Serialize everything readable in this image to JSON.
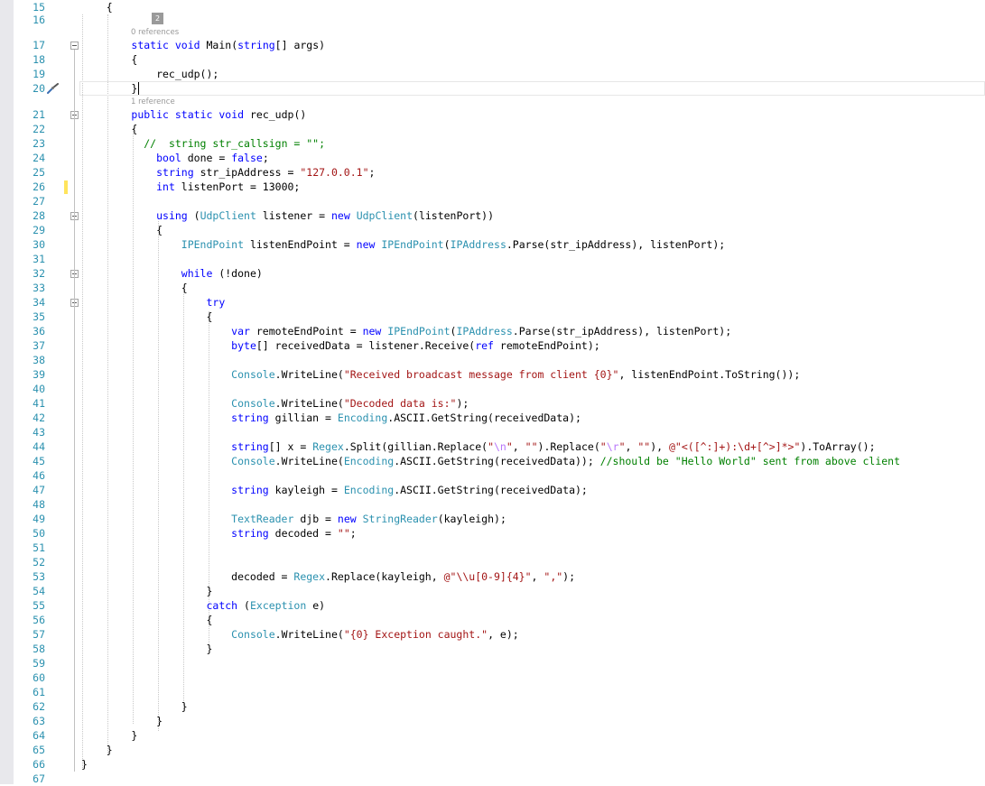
{
  "editor": {
    "colors": {
      "keyword": "#0000ff",
      "type": "#2b91af",
      "string": "#a31515",
      "comment": "#008000",
      "line_number": "#2b91af",
      "change_marker": "#ffe45c"
    },
    "hint_badge": "2",
    "ref_hints": [
      {
        "text": "0 references",
        "before_line": 17
      },
      {
        "text": "1 reference",
        "before_line": 21
      }
    ],
    "quick_action_icon": "screwdriver-brush-icon",
    "lines": [
      {
        "n": "15",
        "tokens": [
          [
            "p",
            "    {"
          ]
        ]
      },
      {
        "n": "16",
        "tokens": []
      },
      {
        "n": "17",
        "tokens": [
          [
            "p",
            "        "
          ],
          [
            "k",
            "static"
          ],
          [
            "p",
            " "
          ],
          [
            "k",
            "void"
          ],
          [
            "p",
            " Main("
          ],
          [
            "k",
            "string"
          ],
          [
            "p",
            "[] args)"
          ]
        ]
      },
      {
        "n": "18",
        "tokens": [
          [
            "p",
            "        {"
          ]
        ]
      },
      {
        "n": "19",
        "tokens": [
          [
            "p",
            "            rec_udp();"
          ]
        ]
      },
      {
        "n": "20",
        "tokens": [
          [
            "p",
            "        }"
          ]
        ]
      },
      {
        "n": "21",
        "tokens": [
          [
            "p",
            "        "
          ],
          [
            "k",
            "public"
          ],
          [
            "p",
            " "
          ],
          [
            "k",
            "static"
          ],
          [
            "p",
            " "
          ],
          [
            "k",
            "void"
          ],
          [
            "p",
            " rec_udp()"
          ]
        ]
      },
      {
        "n": "22",
        "tokens": [
          [
            "p",
            "        {"
          ]
        ]
      },
      {
        "n": "23",
        "tokens": [
          [
            "p",
            "          "
          ],
          [
            "c",
            "//  string str_callsign = \"\";"
          ]
        ]
      },
      {
        "n": "24",
        "tokens": [
          [
            "p",
            "            "
          ],
          [
            "k",
            "bool"
          ],
          [
            "p",
            " done = "
          ],
          [
            "k",
            "false"
          ],
          [
            "p",
            ";"
          ]
        ]
      },
      {
        "n": "25",
        "tokens": [
          [
            "p",
            "            "
          ],
          [
            "k",
            "string"
          ],
          [
            "p",
            " str_ipAddress = "
          ],
          [
            "s",
            "\"127.0.0.1\""
          ],
          [
            "p",
            ";"
          ]
        ]
      },
      {
        "n": "26",
        "tokens": [
          [
            "p",
            "            "
          ],
          [
            "k",
            "int"
          ],
          [
            "p",
            " listenPort = 13000;"
          ]
        ]
      },
      {
        "n": "27",
        "tokens": []
      },
      {
        "n": "28",
        "tokens": [
          [
            "p",
            "            "
          ],
          [
            "k",
            "using"
          ],
          [
            "p",
            " ("
          ],
          [
            "t",
            "UdpClient"
          ],
          [
            "p",
            " listener = "
          ],
          [
            "k",
            "new"
          ],
          [
            "p",
            " "
          ],
          [
            "t",
            "UdpClient"
          ],
          [
            "p",
            "(listenPort))"
          ]
        ]
      },
      {
        "n": "29",
        "tokens": [
          [
            "p",
            "            {"
          ]
        ]
      },
      {
        "n": "30",
        "tokens": [
          [
            "p",
            "                "
          ],
          [
            "t",
            "IPEndPoint"
          ],
          [
            "p",
            " listenEndPoint = "
          ],
          [
            "k",
            "new"
          ],
          [
            "p",
            " "
          ],
          [
            "t",
            "IPEndPoint"
          ],
          [
            "p",
            "("
          ],
          [
            "t",
            "IPAddress"
          ],
          [
            "p",
            ".Parse(str_ipAddress), listenPort);"
          ]
        ]
      },
      {
        "n": "31",
        "tokens": []
      },
      {
        "n": "32",
        "tokens": [
          [
            "p",
            "                "
          ],
          [
            "k",
            "while"
          ],
          [
            "p",
            " (!done)"
          ]
        ]
      },
      {
        "n": "33",
        "tokens": [
          [
            "p",
            "                {"
          ]
        ]
      },
      {
        "n": "34",
        "tokens": [
          [
            "p",
            "                    "
          ],
          [
            "k",
            "try"
          ]
        ]
      },
      {
        "n": "35",
        "tokens": [
          [
            "p",
            "                    {"
          ]
        ]
      },
      {
        "n": "36",
        "tokens": [
          [
            "p",
            "                        "
          ],
          [
            "k",
            "var"
          ],
          [
            "p",
            " remoteEndPoint = "
          ],
          [
            "k",
            "new"
          ],
          [
            "p",
            " "
          ],
          [
            "t",
            "IPEndPoint"
          ],
          [
            "p",
            "("
          ],
          [
            "t",
            "IPAddress"
          ],
          [
            "p",
            ".Parse(str_ipAddress), listenPort);"
          ]
        ]
      },
      {
        "n": "37",
        "tokens": [
          [
            "p",
            "                        "
          ],
          [
            "k",
            "byte"
          ],
          [
            "p",
            "[] receivedData = listener.Receive("
          ],
          [
            "k",
            "ref"
          ],
          [
            "p",
            " remoteEndPoint);"
          ]
        ]
      },
      {
        "n": "38",
        "tokens": []
      },
      {
        "n": "39",
        "tokens": [
          [
            "p",
            "                        "
          ],
          [
            "t",
            "Console"
          ],
          [
            "p",
            ".WriteLine("
          ],
          [
            "s",
            "\"Received broadcast message from client {0}\""
          ],
          [
            "p",
            ", listenEndPoint.ToString());"
          ]
        ]
      },
      {
        "n": "40",
        "tokens": []
      },
      {
        "n": "41",
        "tokens": [
          [
            "p",
            "                        "
          ],
          [
            "t",
            "Console"
          ],
          [
            "p",
            ".WriteLine("
          ],
          [
            "s",
            "\"Decoded data is:\""
          ],
          [
            "p",
            ");"
          ]
        ]
      },
      {
        "n": "42",
        "tokens": [
          [
            "p",
            "                        "
          ],
          [
            "k",
            "string"
          ],
          [
            "p",
            " gillian = "
          ],
          [
            "t",
            "Encoding"
          ],
          [
            "p",
            ".ASCII.GetString(receivedData);"
          ]
        ]
      },
      {
        "n": "43",
        "tokens": []
      },
      {
        "n": "44",
        "tokens": [
          [
            "p",
            "                        "
          ],
          [
            "k",
            "string"
          ],
          [
            "p",
            "[] x = "
          ],
          [
            "t",
            "Regex"
          ],
          [
            "p",
            ".Split(gillian.Replace("
          ],
          [
            "s",
            "\""
          ],
          [
            "e",
            "\\n"
          ],
          [
            "s",
            "\""
          ],
          [
            "p",
            ", "
          ],
          [
            "s",
            "\"\""
          ],
          [
            "p",
            ").Replace("
          ],
          [
            "s",
            "\""
          ],
          [
            "e",
            "\\r"
          ],
          [
            "s",
            "\""
          ],
          [
            "p",
            ", "
          ],
          [
            "s",
            "\"\""
          ],
          [
            "p",
            "), "
          ],
          [
            "s",
            "@\"<([^:]+):\\d+[^>]*>\""
          ],
          [
            "p",
            ").ToArray();"
          ]
        ]
      },
      {
        "n": "45",
        "tokens": [
          [
            "p",
            "                        "
          ],
          [
            "t",
            "Console"
          ],
          [
            "p",
            ".WriteLine("
          ],
          [
            "t",
            "Encoding"
          ],
          [
            "p",
            ".ASCII.GetString(receivedData)); "
          ],
          [
            "c",
            "//should be \"Hello World\" sent from above client"
          ]
        ]
      },
      {
        "n": "46",
        "tokens": []
      },
      {
        "n": "47",
        "tokens": [
          [
            "p",
            "                        "
          ],
          [
            "k",
            "string"
          ],
          [
            "p",
            " kayleigh = "
          ],
          [
            "t",
            "Encoding"
          ],
          [
            "p",
            ".ASCII.GetString(receivedData);"
          ]
        ]
      },
      {
        "n": "48",
        "tokens": []
      },
      {
        "n": "49",
        "tokens": [
          [
            "p",
            "                        "
          ],
          [
            "t",
            "TextReader"
          ],
          [
            "p",
            " djb = "
          ],
          [
            "k",
            "new"
          ],
          [
            "p",
            " "
          ],
          [
            "t",
            "StringReader"
          ],
          [
            "p",
            "(kayleigh);"
          ]
        ]
      },
      {
        "n": "50",
        "tokens": [
          [
            "p",
            "                        "
          ],
          [
            "k",
            "string"
          ],
          [
            "p",
            " decoded = "
          ],
          [
            "s",
            "\"\""
          ],
          [
            "p",
            ";"
          ]
        ]
      },
      {
        "n": "51",
        "tokens": []
      },
      {
        "n": "52",
        "tokens": []
      },
      {
        "n": "53",
        "tokens": [
          [
            "p",
            "                        decoded = "
          ],
          [
            "t",
            "Regex"
          ],
          [
            "p",
            ".Replace(kayleigh, "
          ],
          [
            "s",
            "@\"\\\\u[0-9]{4}\""
          ],
          [
            "p",
            ", "
          ],
          [
            "s",
            "\",\""
          ],
          [
            "p",
            ");"
          ]
        ]
      },
      {
        "n": "54",
        "tokens": [
          [
            "p",
            "                    }"
          ]
        ]
      },
      {
        "n": "55",
        "tokens": [
          [
            "p",
            "                    "
          ],
          [
            "k",
            "catch"
          ],
          [
            "p",
            " ("
          ],
          [
            "t",
            "Exception"
          ],
          [
            "p",
            " e)"
          ]
        ]
      },
      {
        "n": "56",
        "tokens": [
          [
            "p",
            "                    {"
          ]
        ]
      },
      {
        "n": "57",
        "tokens": [
          [
            "p",
            "                        "
          ],
          [
            "t",
            "Console"
          ],
          [
            "p",
            ".WriteLine("
          ],
          [
            "s",
            "\"{0} Exception caught.\""
          ],
          [
            "p",
            ", e);"
          ]
        ]
      },
      {
        "n": "58",
        "tokens": [
          [
            "p",
            "                    }"
          ]
        ]
      },
      {
        "n": "59",
        "tokens": []
      },
      {
        "n": "60",
        "tokens": []
      },
      {
        "n": "61",
        "tokens": []
      },
      {
        "n": "62",
        "tokens": [
          [
            "p",
            "                }"
          ]
        ]
      },
      {
        "n": "63",
        "tokens": [
          [
            "p",
            "            }"
          ]
        ]
      },
      {
        "n": "64",
        "tokens": [
          [
            "p",
            "        }"
          ]
        ]
      },
      {
        "n": "65",
        "tokens": [
          [
            "p",
            "    }"
          ]
        ]
      },
      {
        "n": "66",
        "tokens": [
          [
            "p",
            "}"
          ]
        ]
      },
      {
        "n": "67",
        "tokens": []
      }
    ]
  }
}
